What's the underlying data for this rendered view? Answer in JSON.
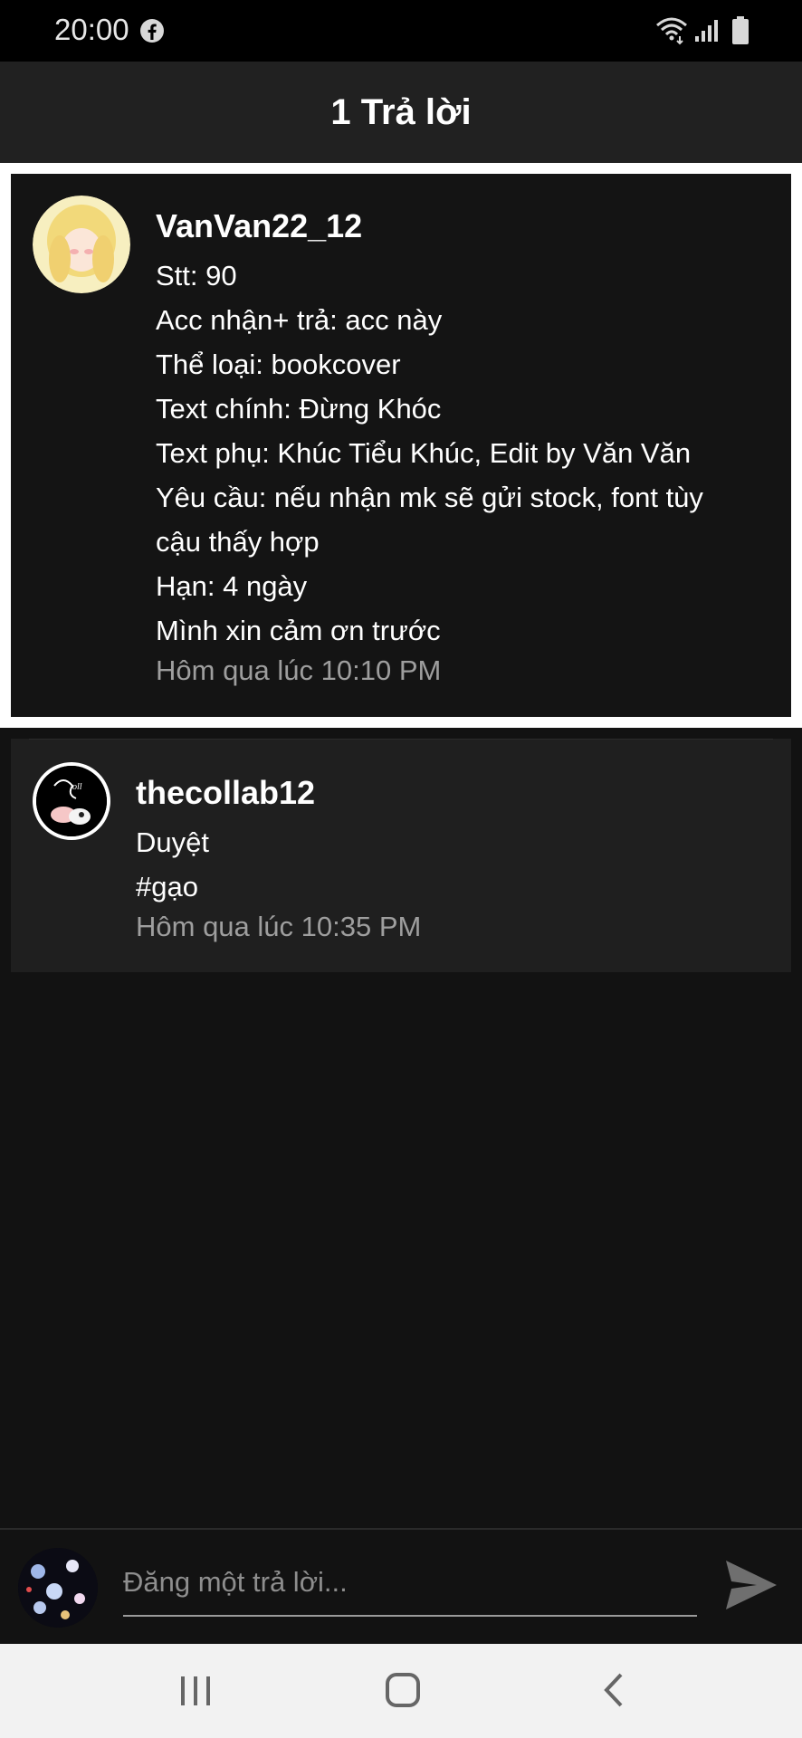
{
  "status_bar": {
    "time": "20:00",
    "icons": [
      "facebook-icon",
      "wifi-icon",
      "signal-icon",
      "battery-icon"
    ]
  },
  "header": {
    "title": "1 Trả lời"
  },
  "original_post": {
    "username": "VanVan22_12",
    "lines": [
      "Stt: 90",
      "Acc nhận+ trả: acc này",
      "Thể loại: bookcover",
      "Text chính: Đừng Khóc",
      "Text phụ: Khúc Tiểu Khúc, Edit by Văn Văn",
      "Yêu cầu: nếu nhận mk sẽ gửi stock, font tùy",
      "cậu thấy hợp",
      "Hạn: 4 ngày",
      "Mình xin cảm ơn trước"
    ],
    "timestamp": "Hôm qua lúc 10:10 PM"
  },
  "reply": {
    "username": "thecollab12",
    "lines": [
      "Duyệt",
      "#gạo"
    ],
    "timestamp": "Hôm qua lúc 10:35 PM"
  },
  "composer": {
    "placeholder": "Đăng một trả lời...",
    "value": ""
  },
  "colors": {
    "background": "#121212",
    "header": "#212121",
    "card": "#1f1f1f",
    "highlight_border": "#ffffff",
    "muted_text": "#9e9e9e",
    "nav_bar": "#f2f2f2"
  }
}
